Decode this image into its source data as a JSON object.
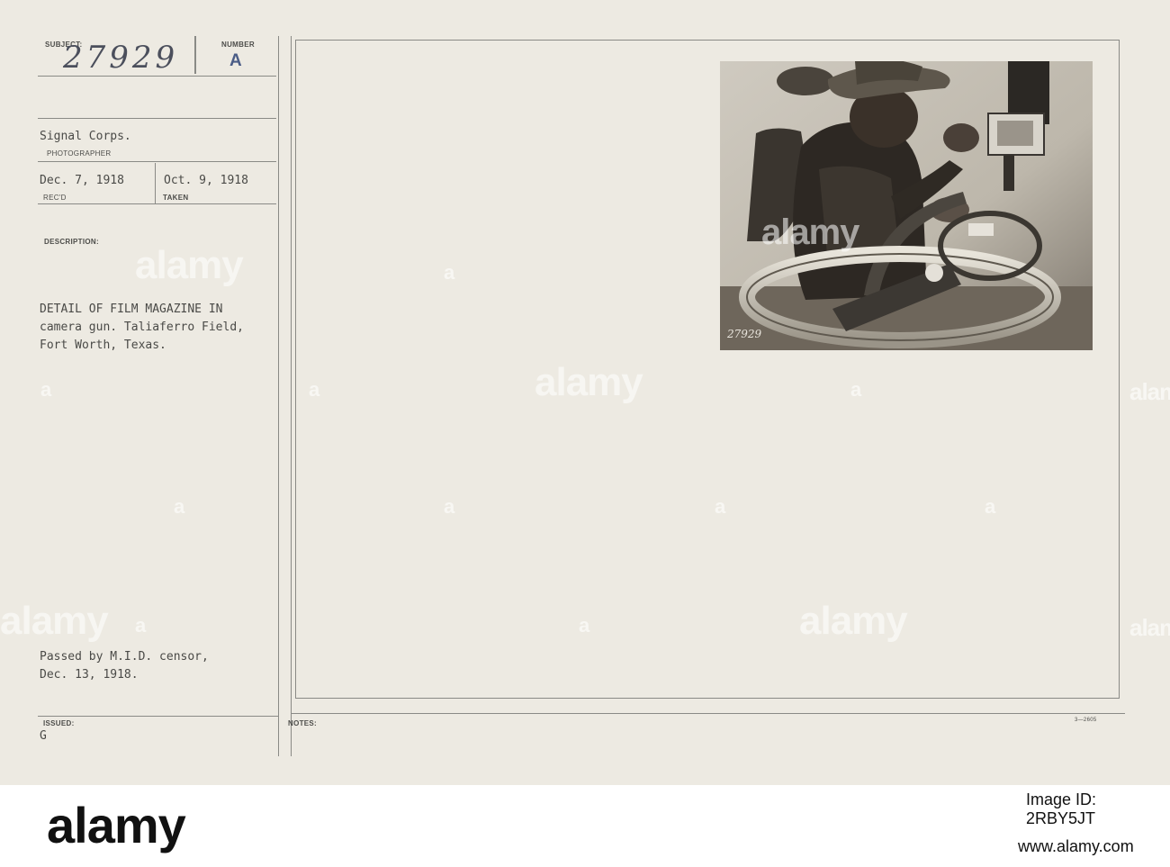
{
  "record": {
    "subject_label": "SUBJECT:",
    "subject_number": "27929",
    "number_label": "NUMBER",
    "number_value": "A",
    "photographer": "Signal Corps.",
    "photographer_label": "PHOTOGRAPHER",
    "received": "Dec. 7, 1918",
    "received_label": "REC'D",
    "taken": "Oct. 9, 1918",
    "taken_label": "TAKEN",
    "description_label": "DESCRIPTION:",
    "description_lines": [
      "DETAIL OF FILM MAGAZINE IN",
      "camera gun. Taliaferro Field,",
      "Fort Worth, Texas."
    ],
    "censor_lines": [
      "Passed by M.I.D. censor,",
      "Dec. 13, 1918."
    ],
    "issued_label": "ISSUED:",
    "issued_value": "G",
    "notes_label": "NOTES:",
    "form_code": "3—2605",
    "photo_stamp": "27929"
  },
  "watermark": "alamy",
  "footer": {
    "brand": "alamy",
    "image_id": "Image ID: 2RBY5JT",
    "url": "www.alamy.com"
  }
}
